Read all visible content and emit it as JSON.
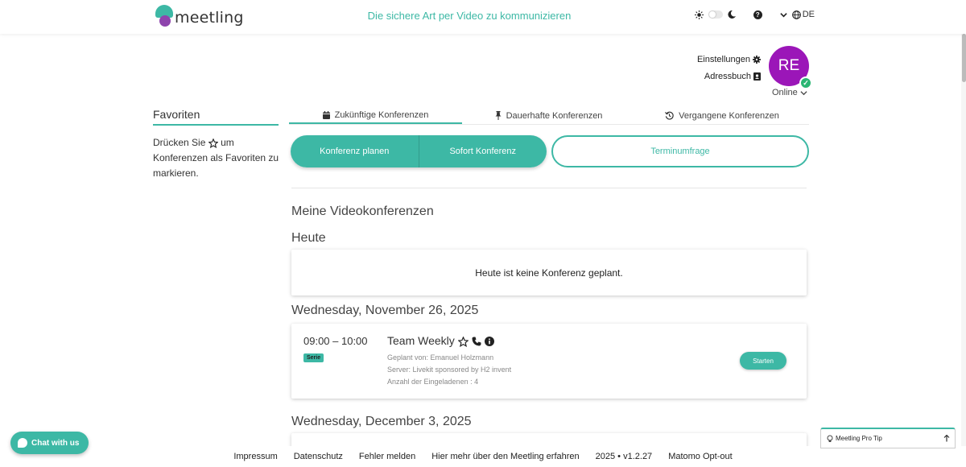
{
  "header": {
    "logo_text": "meetling",
    "tagline": "Die sichere Art per Video zu kommunizieren",
    "language": "DE"
  },
  "user": {
    "settings_label": "Einstellungen",
    "addressbook_label": "Adressbuch",
    "initials": "RE",
    "status": "Online"
  },
  "sidebar": {
    "title": "Favoriten",
    "hint_prefix": "Drücken Sie",
    "hint_suffix": "um Konferenzen als Favoriten zu markieren."
  },
  "tabs": [
    {
      "label": "Zukünftige Konferenzen",
      "icon": "calendar-icon",
      "active": true
    },
    {
      "label": "Dauerhafte Konferenzen",
      "icon": "pin-icon",
      "active": false
    },
    {
      "label": "Vergangene Konferenzen",
      "icon": "history-icon",
      "active": false
    }
  ],
  "actions": {
    "plan": "Konferenz planen",
    "instant": "Sofort Konferenz",
    "poll": "Terminumfrage"
  },
  "main": {
    "title": "Meine Videokonferenzen",
    "today": "Heute",
    "today_empty": "Heute ist keine Konferenz geplant.",
    "date1": "Wednesday, November 26, 2025",
    "date2": "Wednesday, December 3, 2025"
  },
  "conference": {
    "time": "09:00 – 10:00",
    "badge": "Serie",
    "title": "Team Weekly",
    "planned_by": "Geplant von: Emanuel Holzmann",
    "server": "Server: Livekit sponsored by H2 invent",
    "invitees": "Anzahl der Eingeladenen : 4",
    "start": "Starten"
  },
  "footer": {
    "links": [
      "Impressum",
      "Datenschutz",
      "Fehler melden",
      "Hier mehr über den Meetling erfahren",
      "2025 • v1.2.27",
      "Matomo Opt-out"
    ]
  },
  "chat_label": "Chat with us",
  "protip_label": "Meetling Pro Tip",
  "colors": {
    "accent": "#3db8a5",
    "avatar": "#9b16b8",
    "online": "#2bb673"
  }
}
